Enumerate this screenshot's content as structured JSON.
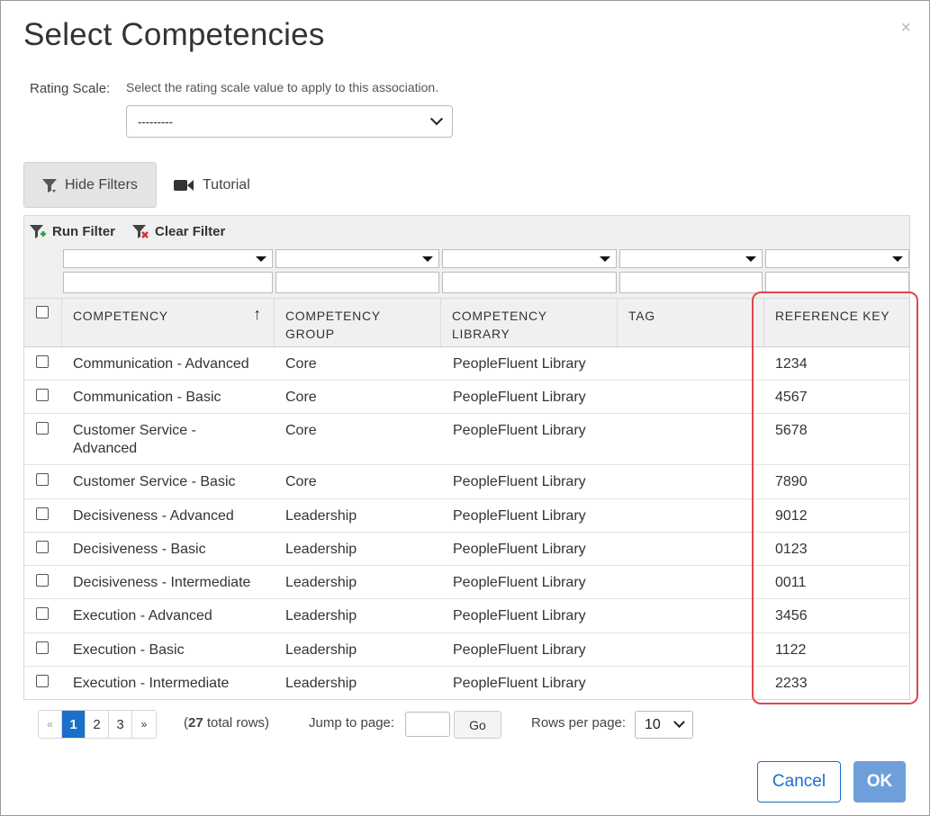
{
  "dialog": {
    "title": "Select Competencies",
    "close_glyph": "×"
  },
  "rating_scale": {
    "label": "Rating Scale:",
    "help": "Select the rating scale value to apply to this association.",
    "selected": "---------"
  },
  "buttons": {
    "hide_filters": "Hide Filters",
    "tutorial": "Tutorial",
    "run_filter": "Run Filter",
    "clear_filter": "Clear Filter",
    "cancel": "Cancel",
    "ok": "OK"
  },
  "table": {
    "columns": [
      {
        "line1": "COMPETENCY",
        "line2": ""
      },
      {
        "line1": "COMPETENCY",
        "line2": "GROUP"
      },
      {
        "line1": "COMPETENCY",
        "line2": "LIBRARY"
      },
      {
        "line1": "TAG",
        "line2": ""
      },
      {
        "line1": "REFERENCE KEY",
        "line2": ""
      }
    ],
    "sort_indicator": "↑",
    "rows": [
      {
        "competency": "Communication - Advanced",
        "group": "Core",
        "library": "PeopleFluent Library",
        "tag": "",
        "key": "1234"
      },
      {
        "competency": "Communication - Basic",
        "group": "Core",
        "library": "PeopleFluent Library",
        "tag": "",
        "key": "4567"
      },
      {
        "competency": "Customer Service - Advanced",
        "group": "Core",
        "library": "PeopleFluent Library",
        "tag": "",
        "key": "5678"
      },
      {
        "competency": "Customer Service - Basic",
        "group": "Core",
        "library": "PeopleFluent Library",
        "tag": "",
        "key": "7890"
      },
      {
        "competency": "Decisiveness - Advanced",
        "group": "Leadership",
        "library": "PeopleFluent Library",
        "tag": "",
        "key": "9012"
      },
      {
        "competency": "Decisiveness - Basic",
        "group": "Leadership",
        "library": "PeopleFluent Library",
        "tag": "",
        "key": "0123"
      },
      {
        "competency": "Decisiveness - Intermediate",
        "group": "Leadership",
        "library": "PeopleFluent Library",
        "tag": "",
        "key": "0011"
      },
      {
        "competency": "Execution - Advanced",
        "group": "Leadership",
        "library": "PeopleFluent Library",
        "tag": "",
        "key": "3456"
      },
      {
        "competency": "Execution - Basic",
        "group": "Leadership",
        "library": "PeopleFluent Library",
        "tag": "",
        "key": "1122"
      },
      {
        "competency": "Execution - Intermediate",
        "group": "Leadership",
        "library": "PeopleFluent Library",
        "tag": "",
        "key": "2233"
      }
    ]
  },
  "pagination": {
    "prev": "«",
    "pages": [
      "1",
      "2",
      "3"
    ],
    "next": "»",
    "active_page": "1",
    "total_count": "27",
    "total_suffix": " total rows)",
    "total_prefix": "(",
    "jump_label": "Jump to page:",
    "go": "Go",
    "rows_per_page_label": "Rows per page:",
    "rows_per_page": "10"
  },
  "colors": {
    "primary": "#1a6fc9",
    "ok_button": "#6f9fdb",
    "highlight": "#e0454b"
  }
}
